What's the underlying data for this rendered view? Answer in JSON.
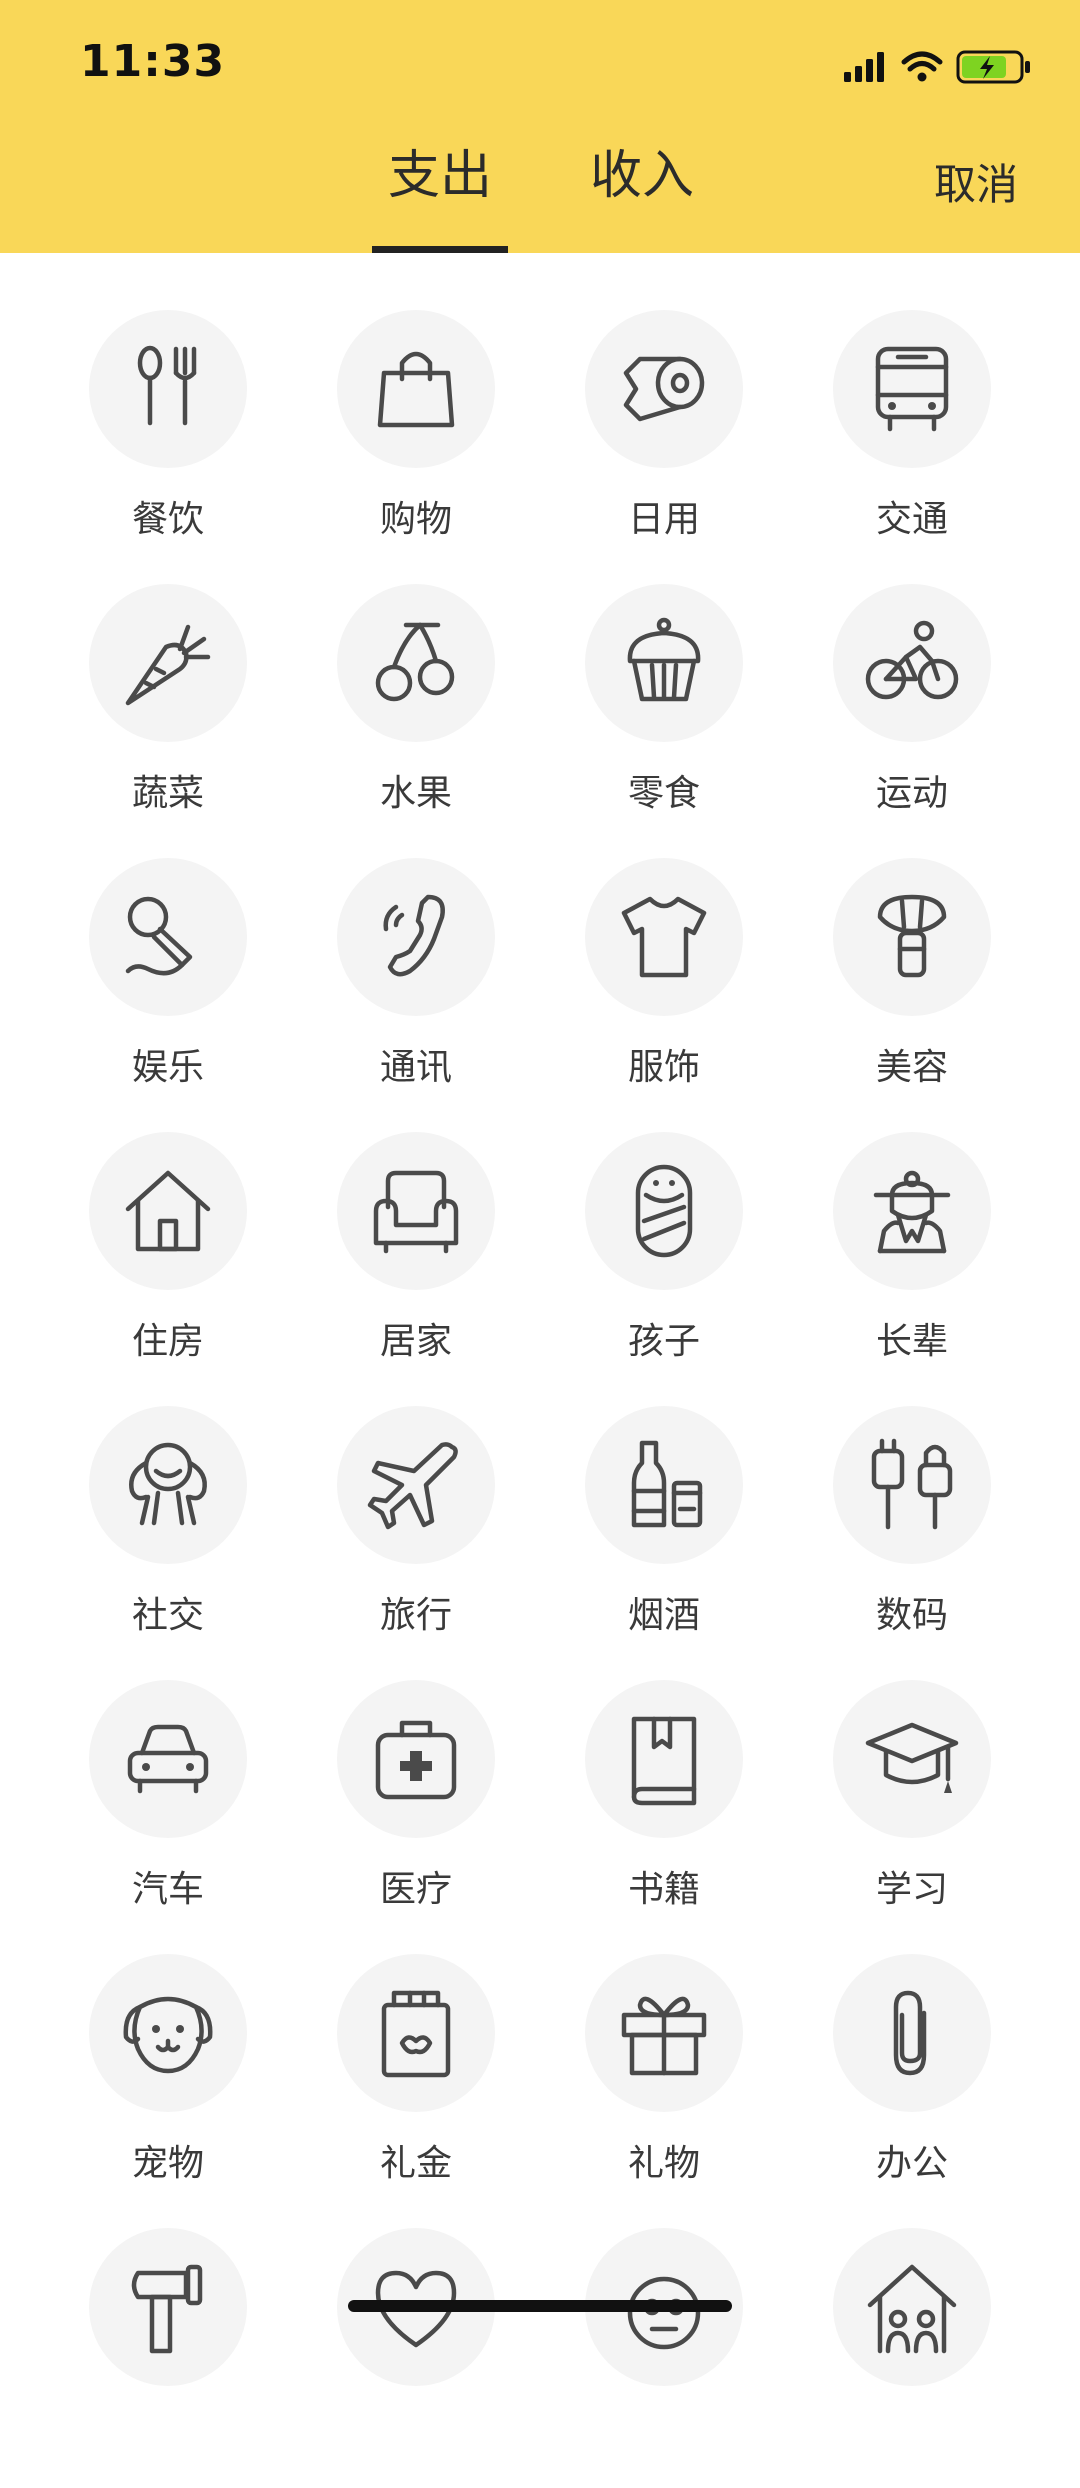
{
  "status_bar": {
    "time": "11:33"
  },
  "header": {
    "tabs": [
      {
        "label": "支出",
        "active": true
      },
      {
        "label": "收入",
        "active": false
      }
    ],
    "cancel_label": "取消"
  },
  "colors": {
    "header_bg": "#F9D758",
    "icon_circle": "#F4F4F4",
    "icon_stroke": "#4a4a4a",
    "battery_fill": "#7ED321"
  },
  "categories": [
    {
      "label": "餐饮",
      "icon": "utensils-icon"
    },
    {
      "label": "购物",
      "icon": "shopping-bag-icon"
    },
    {
      "label": "日用",
      "icon": "tissue-roll-icon"
    },
    {
      "label": "交通",
      "icon": "bus-icon"
    },
    {
      "label": "蔬菜",
      "icon": "carrot-icon"
    },
    {
      "label": "水果",
      "icon": "cherry-icon"
    },
    {
      "label": "零食",
      "icon": "cupcake-icon"
    },
    {
      "label": "运动",
      "icon": "cyclist-icon"
    },
    {
      "label": "娱乐",
      "icon": "microphone-icon"
    },
    {
      "label": "通讯",
      "icon": "phone-icon"
    },
    {
      "label": "服饰",
      "icon": "tshirt-icon"
    },
    {
      "label": "美容",
      "icon": "makeup-brush-icon"
    },
    {
      "label": "住房",
      "icon": "house-icon"
    },
    {
      "label": "居家",
      "icon": "armchair-icon"
    },
    {
      "label": "孩子",
      "icon": "baby-icon"
    },
    {
      "label": "长辈",
      "icon": "elder-icon"
    },
    {
      "label": "社交",
      "icon": "people-hug-icon"
    },
    {
      "label": "旅行",
      "icon": "airplane-icon"
    },
    {
      "label": "烟酒",
      "icon": "bottle-icon"
    },
    {
      "label": "数码",
      "icon": "plug-icon"
    },
    {
      "label": "汽车",
      "icon": "car-icon"
    },
    {
      "label": "医疗",
      "icon": "medical-kit-icon"
    },
    {
      "label": "书籍",
      "icon": "book-icon"
    },
    {
      "label": "学习",
      "icon": "graduation-cap-icon"
    },
    {
      "label": "宠物",
      "icon": "dog-icon"
    },
    {
      "label": "礼金",
      "icon": "red-envelope-icon"
    },
    {
      "label": "礼物",
      "icon": "gift-icon"
    },
    {
      "label": "办公",
      "icon": "paperclip-icon"
    },
    {
      "label": "",
      "icon": "hammer-icon"
    },
    {
      "label": "",
      "icon": "heart-icon"
    },
    {
      "label": "",
      "icon": "face-icon"
    },
    {
      "label": "",
      "icon": "family-house-icon"
    }
  ]
}
